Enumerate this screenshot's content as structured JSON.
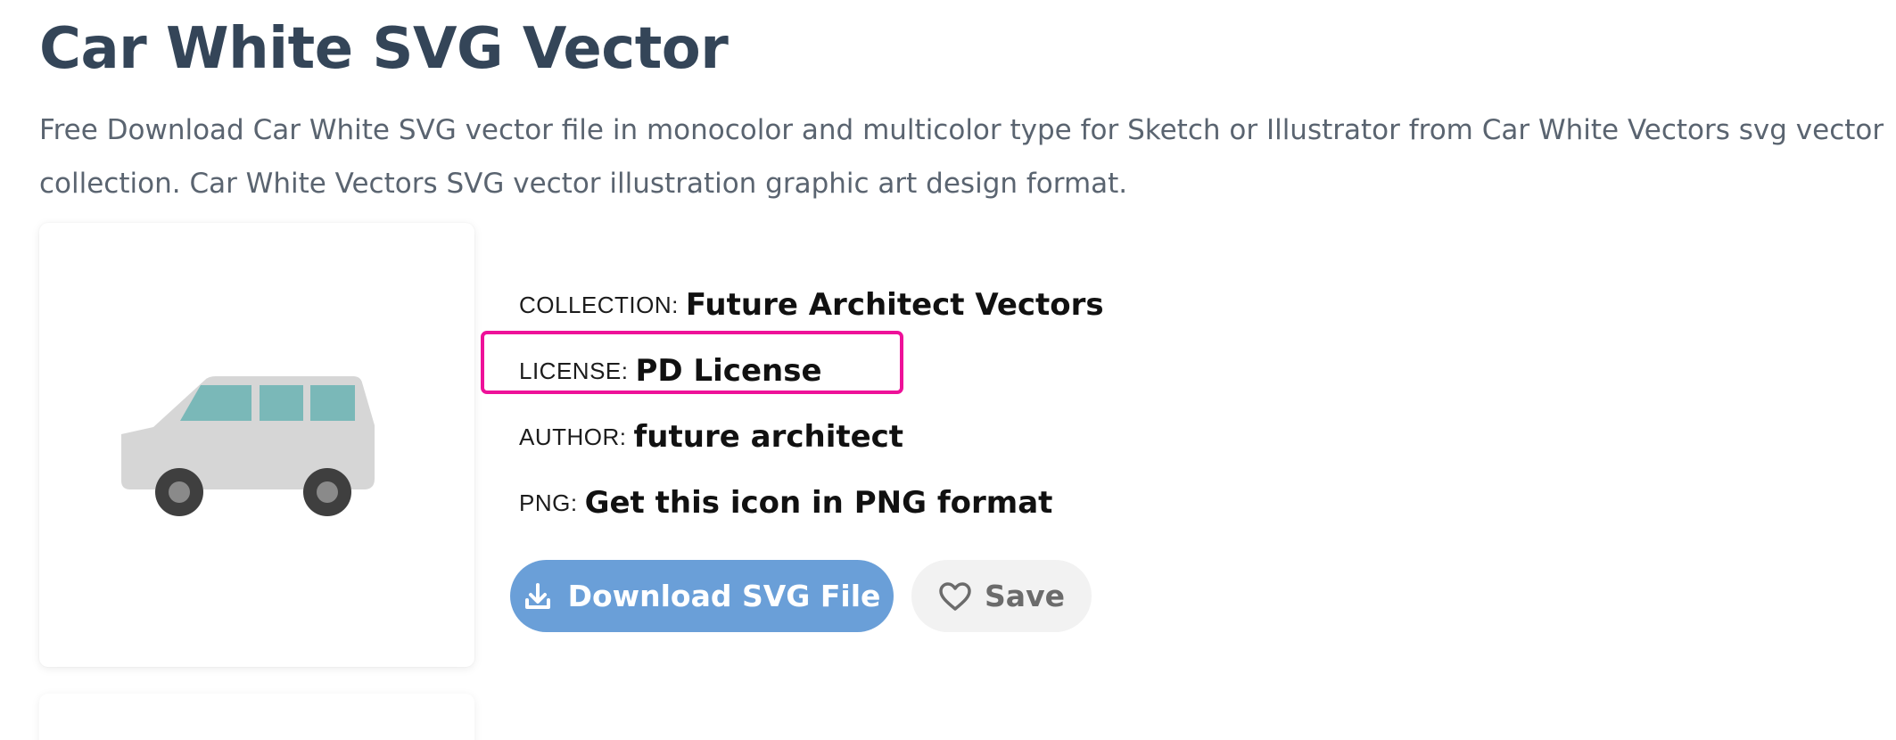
{
  "page": {
    "title": "Car White SVG Vector",
    "description_lines": [
      "Free Download Car White SVG vector file in monocolor and multicolor type for Sketch or Illustrator from Car White Vectors svg vector",
      "collection. Car White Vectors SVG vector illustration graphic art design format."
    ]
  },
  "preview": {
    "icon": "car-white-van-icon",
    "colors": {
      "body": "#d6d6d6",
      "windows": "#7ab8b8",
      "wheels": "#3f3f3f",
      "hubs": "#8a8a8a"
    }
  },
  "meta": {
    "collection_key": "COLLECTION:",
    "collection_value": "Future Architect Vectors",
    "license_key": "LICENSE:",
    "license_value": "PD License",
    "author_key": "AUTHOR:",
    "author_value": "future architect",
    "png_key": "PNG:",
    "png_value": "Get this icon in PNG format"
  },
  "actions": {
    "download_label": "Download SVG File",
    "download_icon": "download-icon",
    "save_label": "Save",
    "save_icon": "heart-icon"
  },
  "colors": {
    "title": "#344558",
    "highlight": "#ee1199",
    "download_button": "#6a9fd8",
    "save_button": "#f2f2f2"
  }
}
